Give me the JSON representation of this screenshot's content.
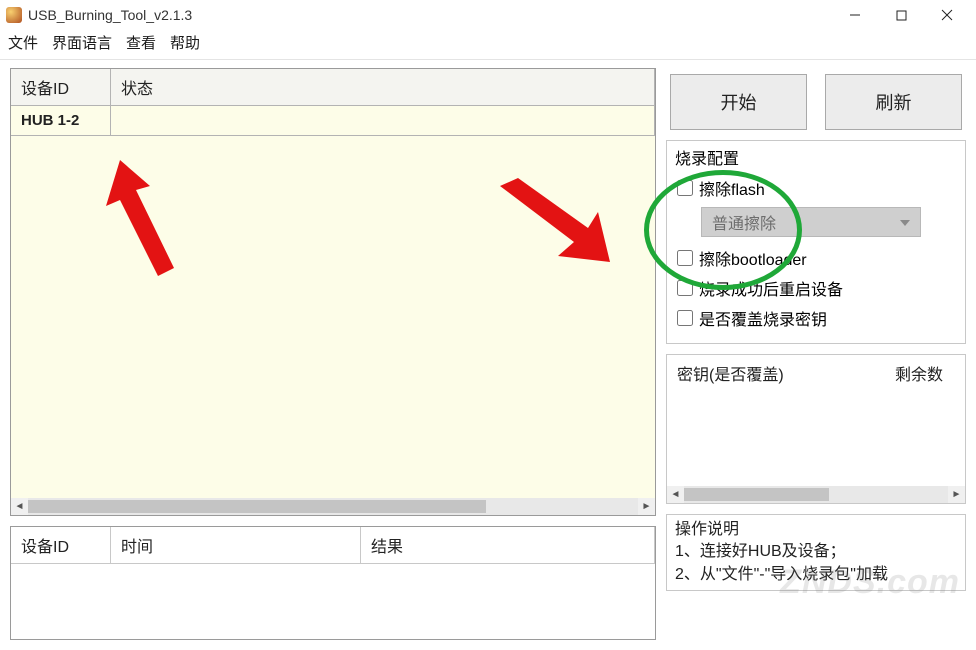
{
  "window": {
    "title": "USB_Burning_Tool_v2.1.3"
  },
  "menu": {
    "file": "文件",
    "lang": "界面语言",
    "view": "查看",
    "help": "帮助"
  },
  "deviceTable": {
    "headers": {
      "id": "设备ID",
      "status": "状态"
    },
    "rows": [
      {
        "id": "HUB 1-2",
        "status": ""
      }
    ]
  },
  "logTable": {
    "headers": {
      "id": "设备ID",
      "time": "时间",
      "result": "结果"
    }
  },
  "buttons": {
    "start": "开始",
    "refresh": "刷新"
  },
  "config": {
    "title": "烧录配置",
    "eraseFlash": {
      "label": "擦除flash",
      "checked": false
    },
    "eraseMode": "普通擦除",
    "eraseBootloader": {
      "label": "擦除bootloader",
      "checked": false
    },
    "rebootAfter": {
      "label": "烧录成功后重启设备",
      "checked": false
    },
    "overwriteKey": {
      "label": "是否覆盖烧录密钥",
      "checked": false
    }
  },
  "keyTable": {
    "headers": {
      "key": "密钥(是否覆盖)",
      "remain": "剩余数"
    }
  },
  "instructions": {
    "title": "操作说明",
    "line1": "1、连接好HUB及设备；",
    "line2": "2、从\"文件\"-\"导入烧录包\"加载"
  },
  "watermark": "ZNDS.com"
}
